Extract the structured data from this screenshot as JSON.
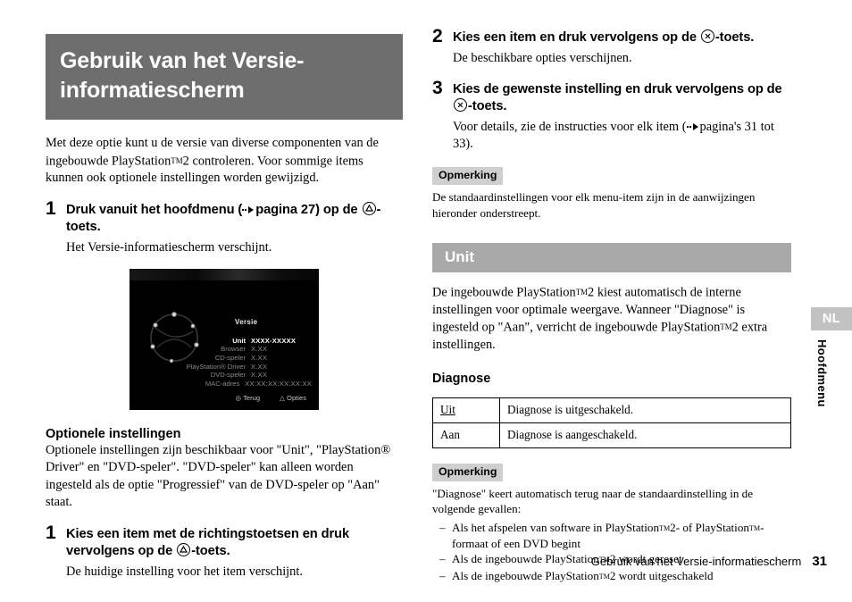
{
  "chapter": {
    "title_line1": "Gebruik van het Versie-",
    "title_line2": "informatiescherm",
    "bar_color": "#6e6e6e"
  },
  "intro": {
    "text_part1": "Met deze optie kunt u de versie van diverse componenten van de ingebouwde PlayStation",
    "tm": "TM",
    "text_part2": "2 controleren. Voor sommige items kunnen ook optionele instellingen worden gewijzigd."
  },
  "steps_left": [
    {
      "number": "1",
      "title_before": "Druk vanuit het hoofdmenu (",
      "title_ref": "pagina 27) op de ",
      "button": "triangle",
      "title_after": "-toets.",
      "body": "Het Versie-informatiescherm verschijnt."
    }
  ],
  "console_screenshot": {
    "title": "Versie",
    "rows": [
      {
        "label": "Unit",
        "value": "XXXX-XXXXX",
        "highlight": true
      },
      {
        "label": "Browser",
        "value": "X.XX",
        "highlight": false
      },
      {
        "label": "CD-speler",
        "value": "X.XX",
        "highlight": false
      },
      {
        "label": "PlayStation® Driver",
        "value": "X.XX",
        "highlight": false
      },
      {
        "label": "DVD-speler",
        "value": "X.XX",
        "highlight": false
      },
      {
        "label": "MAC-adres",
        "value": "XX:XX:XX:XX:XX:XX",
        "highlight": false
      }
    ],
    "footer_back": "Terug",
    "footer_options": "Opties"
  },
  "optional_settings": {
    "heading": "Optionele instellingen",
    "body": "Optionele instellingen zijn beschikbaar voor \"Unit\", \"PlayStation® Driver\" en \"DVD-speler\". \"DVD-speler\" kan alleen worden ingesteld als de optie \"Progressief\" van de DVD-speler op \"Aan\" staat.",
    "step": {
      "number": "1",
      "title_before": "Kies een item met de richtingstoetsen en druk vervolgens op de ",
      "button": "triangle",
      "title_after": "-toets.",
      "body": "De huidige instelling voor het item verschijnt."
    }
  },
  "steps_right": [
    {
      "number": "2",
      "title_before": "Kies een item en druk vervolgens op de ",
      "button": "cross",
      "title_after": "-toets.",
      "body": "De beschikbare opties verschijnen."
    },
    {
      "number": "3",
      "title_before": "Kies de gewenste instelling en druk vervolgens op de ",
      "button": "cross",
      "title_after": "-toets.",
      "body_before": "Voor details, zie de instructies voor elk item (",
      "body_after": "pagina's 31 tot 33)."
    }
  ],
  "note_top": {
    "badge": "Opmerking",
    "body": "De standaardinstellingen voor elk menu-item zijn in de aanwijzingen hieronder onderstreept."
  },
  "unit_section": {
    "bar_title": "Unit",
    "bar_color": "#a9a9a9",
    "body_part1": "De ingebouwde PlayStation",
    "tm": "TM",
    "body_part2": "2 kiest automatisch de interne instellingen voor optimale weergave. Wanneer \"Diagnose\" is ingesteld op \"Aan\", verricht de ingebouwde PlayStation",
    "body_part3": "2 extra instellingen.",
    "sub_heading": "Diagnose"
  },
  "diagnose_table": {
    "rows": [
      {
        "key": "Uit",
        "is_default": true,
        "description": "Diagnose is uitgeschakeld."
      },
      {
        "key": "Aan",
        "is_default": false,
        "description": "Diagnose is aangeschakeld."
      }
    ]
  },
  "note_bottom": {
    "badge": "Opmerking",
    "body": "\"Diagnose\" keert automatisch terug naar de standaardinstelling in de volgende gevallen:",
    "items": [
      {
        "dash": "–",
        "text_a": "Als het afspelen van software in PlayStation",
        "tm1": "TM",
        "text_b": "2- of PlayStation",
        "tm2": "TM",
        "text_c": "-formaat of een DVD begint"
      },
      {
        "dash": "–",
        "text_a": "Als de ingebouwde PlayStation",
        "tm1": "TM",
        "text_b": "2 wordt gereset"
      },
      {
        "dash": "–",
        "text_a": "Als de ingebouwde PlayStation",
        "tm1": "TM",
        "text_b": "2 wordt uitgeschakeld"
      }
    ]
  },
  "side_tab": {
    "language": "NL",
    "section_label": "Hoofdmenu"
  },
  "footer": {
    "running_title": "Gebruik van het Versie-informatiescherm",
    "page_number": "31"
  }
}
